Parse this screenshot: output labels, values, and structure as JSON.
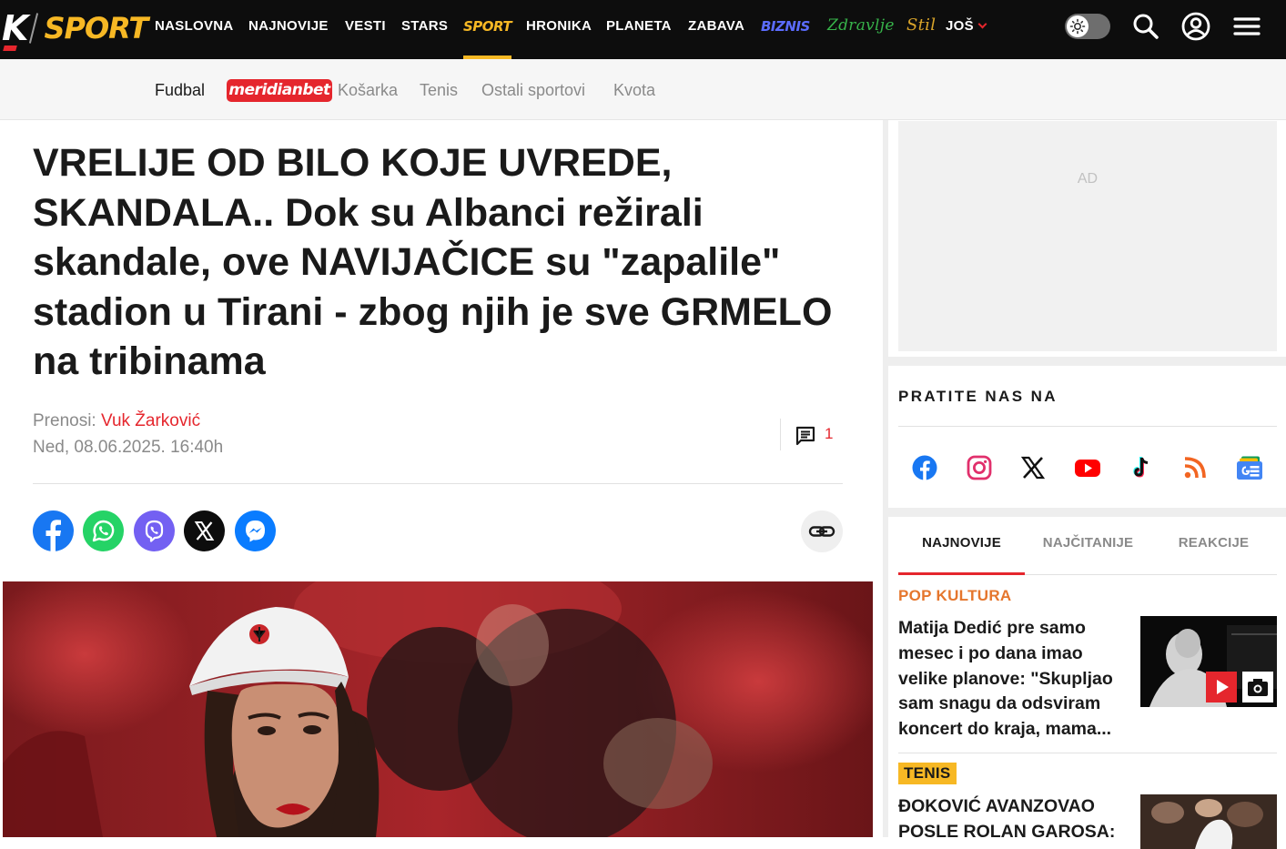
{
  "topnav": {
    "logo": {
      "k": "K",
      "sport": "SPORT"
    },
    "links": [
      "NASLOVNA",
      "NAJNOVIJE",
      "VESTI",
      "STARS",
      "SPORT",
      "HRONIKA",
      "PLANETA",
      "ZABAVA",
      "BIZNIS",
      "Zdravlje",
      "Stil",
      "JOŠ"
    ],
    "active": "SPORT",
    "accent": "#f7b824",
    "icons": [
      "theme-toggle",
      "search-icon",
      "account-icon",
      "menu-icon"
    ]
  },
  "subnav": {
    "items": [
      "Fudbal",
      "meridianbet",
      "Košarka",
      "Tenis",
      "Ostali sportovi",
      "Kvota"
    ]
  },
  "article": {
    "headline": "VRELIJE OD BILO KOJE UVREDE, SKANDALA.. Dok su Albanci režirali skandale, ove NAVIJAČICE su \"zapalile\" stadion u Tirani - zbog njih je sve GRMELO na tribinama",
    "byline_prefix": "Prenosi:",
    "author": "Vuk Žarković",
    "date": "Ned, 08.06.2025. 16:40h",
    "comments": "1",
    "share": [
      "facebook",
      "whatsapp",
      "viber",
      "x",
      "messenger"
    ]
  },
  "sidebar": {
    "ad_label": "AD",
    "follow_title": "PRATITE NAS NA",
    "socials": [
      "facebook",
      "instagram",
      "x",
      "youtube",
      "tiktok",
      "rss",
      "google-news"
    ],
    "tabs": [
      "NAJNOVIJE",
      "NAJČITANIJE",
      "REAKCIJE"
    ],
    "active_tab": "NAJNOVIJE",
    "news": [
      {
        "category": "POP KULTURA",
        "title": "Matija Dedić pre samo mesec i po dana imao velike planove: \"Skupljao sam snagu da odsviram koncert do kraja, mama..."
      },
      {
        "category": "TENIS",
        "title": "ĐOKOVIĆ AVANZOVAO POSLE ROLAN GAROSA:"
      }
    ]
  },
  "colors": {
    "brand_red": "#e5262d",
    "sport_yellow": "#f7b824",
    "nav_bg": "#0d0d0d",
    "pop_orange": "#e5762d"
  }
}
